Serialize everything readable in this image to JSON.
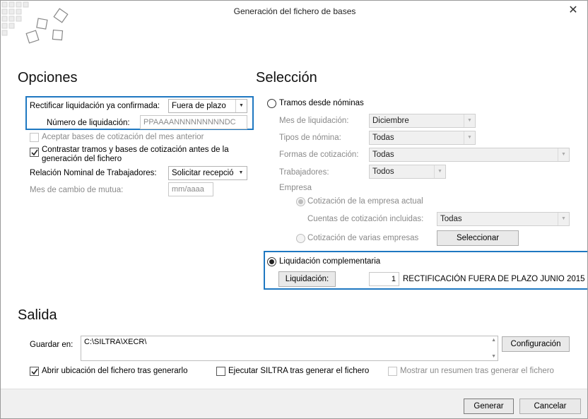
{
  "window": {
    "title": "Generación del fichero de bases",
    "close_glyph": "✕"
  },
  "opciones": {
    "heading": "Opciones",
    "rectificar_label": "Rectificar liquidación ya confirmada:",
    "rectificar_value": "Fuera de plazo",
    "numero_label": "Número de liquidación:",
    "numero_placeholder": "PPAAAANNNNNNNNNDC",
    "aceptar_label": "Aceptar bases de cotización del mes anterior",
    "aceptar_checked": false,
    "contrastar_label_1": "Contrastar tramos y bases de cotización antes de la",
    "contrastar_label_2": "generación del fichero",
    "contrastar_checked": true,
    "relacion_label": "Relación Nominal de Trabajadores:",
    "relacion_value": "Solicitar recepció",
    "mes_cambio_label": "Mes de cambio de mutua:",
    "mes_cambio_placeholder": "mm/aaaa"
  },
  "seleccion": {
    "heading": "Selección",
    "tramos_label": "Tramos desde nóminas",
    "mes_liq_label": "Mes de liquidación:",
    "mes_liq_value": "Diciembre",
    "tipos_label": "Tipos de nómina:",
    "tipos_value": "Todas",
    "formas_label": "Formas de cotización:",
    "formas_value": "Todas",
    "trabajadores_label": "Trabajadores:",
    "trabajadores_value": "Todos",
    "empresa_label": "Empresa",
    "cot_actual_label": "Cotización de la empresa actual",
    "cuentas_label": "Cuentas de cotización incluidas:",
    "cuentas_value": "Todas",
    "cot_varias_label": "Cotización de varias empresas",
    "seleccionar_button": "Seleccionar",
    "liq_comp_label": "Liquidación complementaria",
    "liquidacion_button": "Liquidación:",
    "liquidacion_number": "1",
    "liquidacion_desc": "RECTIFICACIÓN FUERA DE PLAZO JUNIO 2015"
  },
  "salida": {
    "heading": "Salida",
    "guardar_label": "Guardar en:",
    "guardar_value": "C:\\SILTRA\\XECR\\",
    "configuracion_button": "Configuración",
    "abrir_label": "Abrir ubicación del fichero tras generarlo",
    "abrir_checked": true,
    "ejecutar_label": "Ejecutar SILTRA tras generar el fichero",
    "ejecutar_checked": false,
    "mostrar_label": "Mostrar un resumen tras generar el fichero",
    "mostrar_checked": false
  },
  "footer": {
    "generar_button": "Generar",
    "cancelar_button": "Cancelar"
  },
  "colors": {
    "highlight": "#1f78c1",
    "button_face": "#e9e9e9",
    "disabled_text": "#8a8a8a"
  }
}
